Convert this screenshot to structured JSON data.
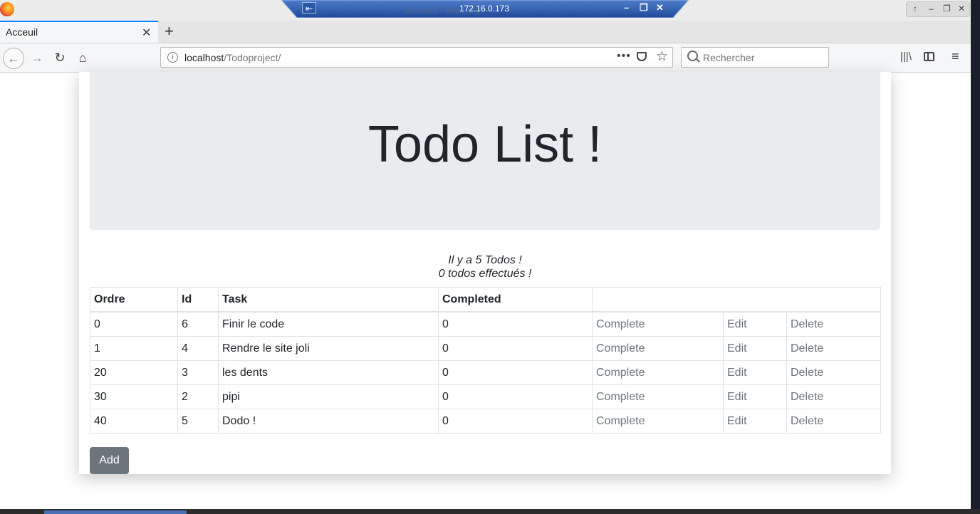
{
  "browser": {
    "remote_host": "172.16.0.173",
    "window_ghost_title": "Acceuil - Mo...ox",
    "tab_title": "Acceuil",
    "url_host": "localhost",
    "url_path": "/Todoproject/",
    "search_placeholder": "Rechercher"
  },
  "page": {
    "title": "Todo List !",
    "todo_count_text": "Il y a 5 Todos !",
    "done_count_text": "0 todos effectués !",
    "add_label": "Add"
  },
  "table": {
    "headers": [
      "Ordre",
      "Id",
      "Task",
      "Completed"
    ],
    "rows": [
      {
        "ordre": "0",
        "id": "6",
        "task": "Finir le code",
        "completed": "0"
      },
      {
        "ordre": "1",
        "id": "4",
        "task": "Rendre le site joli",
        "completed": "0"
      },
      {
        "ordre": "20",
        "id": "3",
        "task": "les dents",
        "completed": "0"
      },
      {
        "ordre": "30",
        "id": "2",
        "task": "pipi",
        "completed": "0"
      },
      {
        "ordre": "40",
        "id": "5",
        "task": "Dodo !",
        "completed": "0"
      }
    ],
    "actions": {
      "complete": "Complete",
      "edit": "Edit",
      "delete": "Delete"
    }
  },
  "icons": {
    "browser_logo": "firefox-logo",
    "back": "back-arrow-icon",
    "forward": "forward-arrow-icon",
    "reload": "reload-icon",
    "home": "home-icon",
    "page_info": "info-icon",
    "page_actions": "more-icon",
    "pocket": "pocket-icon",
    "bookmark": "star-icon",
    "search": "search-icon",
    "library": "library-icon",
    "sidebar": "sidebar-icon",
    "menu": "hamburger-menu-icon"
  },
  "colors": {
    "jumbotron_bg": "#e9ecef",
    "button_secondary": "#6c757d",
    "action_link": "#6c757d",
    "tab_accent": "#0a84ff"
  }
}
